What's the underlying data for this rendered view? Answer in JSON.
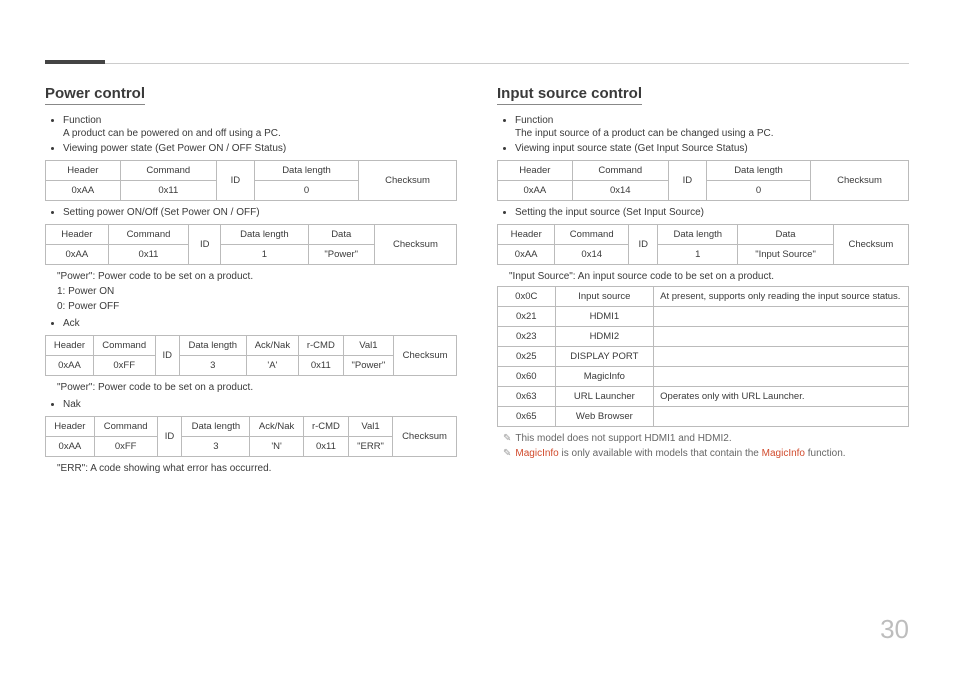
{
  "pageNumber": "30",
  "left": {
    "title": "Power control",
    "function_label": "Function",
    "function_desc": "A product can be powered on and off using a PC.",
    "view_label": "Viewing power state (Get Power ON / OFF Status)",
    "t1": {
      "h1": "Header",
      "h2": "Command",
      "h3": "ID",
      "h4": "Data length",
      "h5": "Checksum",
      "v1": "0xAA",
      "v2": "0x11",
      "v4": "0"
    },
    "set_label": "Setting power ON/Off (Set Power ON / OFF)",
    "t2": {
      "h1": "Header",
      "h2": "Command",
      "h3": "ID",
      "h4": "Data length",
      "h5": "Data",
      "h6": "Checksum",
      "v1": "0xAA",
      "v2": "0x11",
      "v4": "1",
      "v5": "\"Power\""
    },
    "note1": "\"Power\": Power code to be set on a product.",
    "note2": "1: Power ON",
    "note3": "0: Power OFF",
    "ack_label": "Ack",
    "t3": {
      "h1": "Header",
      "h2": "Command",
      "h3": "ID",
      "h4": "Data length",
      "h5": "Ack/Nak",
      "h6": "r-CMD",
      "h7": "Val1",
      "h8": "Checksum",
      "v1": "0xAA",
      "v2": "0xFF",
      "v4": "3",
      "v5": "'A'",
      "v6": "0x11",
      "v7": "\"Power\""
    },
    "note4": "\"Power\": Power code to be set on a product.",
    "nak_label": "Nak",
    "t4": {
      "h1": "Header",
      "h2": "Command",
      "h3": "ID",
      "h4": "Data length",
      "h5": "Ack/Nak",
      "h6": "r-CMD",
      "h7": "Val1",
      "h8": "Checksum",
      "v1": "0xAA",
      "v2": "0xFF",
      "v4": "3",
      "v5": "'N'",
      "v6": "0x11",
      "v7": "\"ERR\""
    },
    "note5": "\"ERR\": A code showing what error has occurred."
  },
  "right": {
    "title": "Input source control",
    "function_label": "Function",
    "function_desc": "The input source of a product can be changed using a PC.",
    "view_label": "Viewing input source state (Get Input Source Status)",
    "t1": {
      "h1": "Header",
      "h2": "Command",
      "h3": "ID",
      "h4": "Data length",
      "h5": "Checksum",
      "v1": "0xAA",
      "v2": "0x14",
      "v4": "0"
    },
    "set_label": "Setting the input source (Set Input Source)",
    "t2": {
      "h1": "Header",
      "h2": "Command",
      "h3": "ID",
      "h4": "Data length",
      "h5": "Data",
      "h6": "Checksum",
      "v1": "0xAA",
      "v2": "0x14",
      "v4": "1",
      "v5": "\"Input Source\""
    },
    "note1": "\"Input Source\": An input source code to be set on a product.",
    "codes": [
      {
        "c": "0x0C",
        "n": "Input source",
        "d": "At present, supports only reading the input source status."
      },
      {
        "c": "0x21",
        "n": "HDMI1",
        "d": ""
      },
      {
        "c": "0x23",
        "n": "HDMI2",
        "d": ""
      },
      {
        "c": "0x25",
        "n": "DISPLAY PORT",
        "d": ""
      },
      {
        "c": "0x60",
        "n": "MagicInfo",
        "d": ""
      },
      {
        "c": "0x63",
        "n": "URL Launcher",
        "d": "Operates only with URL Launcher."
      },
      {
        "c": "0x65",
        "n": "Web Browser",
        "d": ""
      }
    ],
    "foot1": "This model does not support HDMI1 and HDMI2.",
    "foot2a": "MagicInfo",
    "foot2b": " is only available with models that contain the ",
    "foot2c": "MagicInfo",
    "foot2d": " function.",
    "pencil": "✎"
  }
}
